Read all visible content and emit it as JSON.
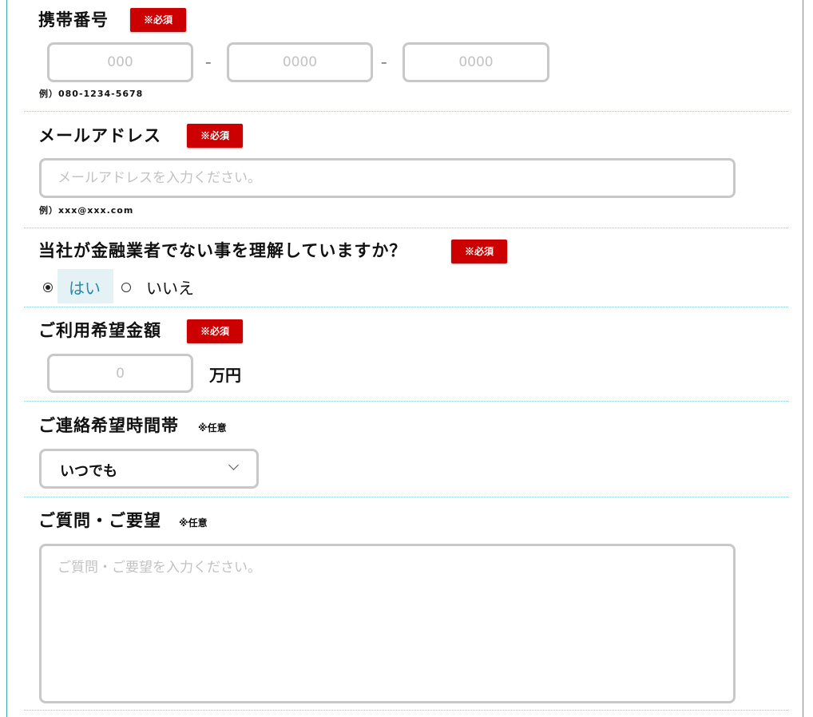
{
  "mobile": {
    "label": "携帯番号",
    "required": "※必須",
    "part1_placeholder": "000",
    "part2_placeholder": "0000",
    "part3_placeholder": "0000",
    "separator": "–",
    "example": "例）080-1234-5678"
  },
  "email": {
    "label": "メールアドレス",
    "required": "※必須",
    "placeholder": "メールアドレスを入力ください。",
    "example": "例）xxx@xxx.com"
  },
  "understanding": {
    "label": "当社が金融業者でない事を理解していますか？",
    "required": "※必須",
    "options": [
      "はい",
      "いいえ"
    ],
    "selected": "はい"
  },
  "amount": {
    "label": "ご利用希望金額",
    "required": "※必須",
    "placeholder": "0",
    "unit": "万円"
  },
  "contact_time": {
    "label": "ご連絡希望時間帯",
    "optional": "※任意",
    "selected": "いつでも"
  },
  "questions": {
    "label": "ご質問・ご要望",
    "optional": "※任意",
    "placeholder": "ご質問・ご要望を入力ください。"
  },
  "colors": {
    "required_badge": "#cc0000",
    "frame_border": "#3aa6a8",
    "divider": "#8fcad6",
    "selected_radio_bg": "#e4f2f6",
    "selected_radio_text": "#2a8aa8",
    "input_border": "#c8c8c8"
  }
}
